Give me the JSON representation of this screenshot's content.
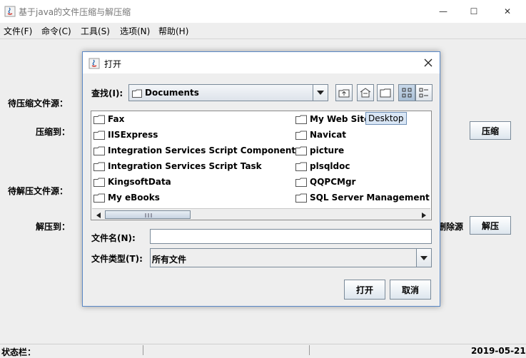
{
  "window": {
    "title": "基于java的文件压缩与解压缩",
    "controls": {
      "minimize": "—",
      "maximize": "☐",
      "close": "✕"
    }
  },
  "menubar": {
    "items": [
      "文件(F)",
      "命令(C)",
      "工具(S)",
      "选项(N)",
      "帮助(H)"
    ]
  },
  "main": {
    "compress_source_label": "待压缩文件源：",
    "compress_to_label": "压缩到：",
    "compress_button": "压缩",
    "decompress_source_label": "待解压文件源：",
    "decompress_to_label": "解压到：",
    "delete_source_label": "删除源",
    "decompress_button": "解压"
  },
  "status": {
    "label": "状态栏：",
    "date": "2019-05-21"
  },
  "dialog": {
    "title": "打开",
    "look_in_label": "查找(I):",
    "look_in_value": "Documents",
    "files_left": [
      "Fax",
      "IISExpress",
      "Integration Services Script Component",
      "Integration Services Script Task",
      "KingsoftData",
      "My eBooks"
    ],
    "files_right": [
      "My Web Sites",
      "Navicat",
      "picture",
      "plsqldoc",
      "QQPCMgr",
      "SQL Server Management Studio"
    ],
    "tooltip": "Desktop",
    "file_name_label": "文件名(N):",
    "file_name_value": "",
    "file_type_label": "文件类型(T):",
    "file_type_value": "所有文件",
    "open_button": "打开",
    "cancel_button": "取消"
  },
  "colors": {
    "dialog_border": "#5a88c6",
    "tooltip_bg": "#d9e6f5",
    "window_bg": "#eeeeee"
  }
}
